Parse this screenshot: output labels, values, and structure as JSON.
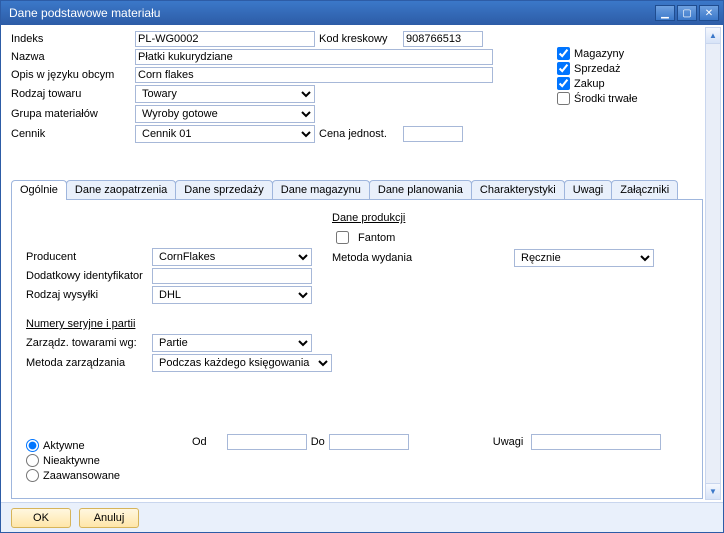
{
  "window": {
    "title": "Dane podstawowe materiału"
  },
  "header": {
    "indeks_label": "Indeks",
    "indeks_value": "PL-WG0002",
    "kod_label": "Kod kreskowy",
    "kod_value": "908766513",
    "nazwa_label": "Nazwa",
    "nazwa_value": "Płatki kukurydziane",
    "opis_label": "Opis w języku obcym",
    "opis_value": "Corn flakes",
    "rodzaj_label": "Rodzaj towaru",
    "rodzaj_value": "Towary",
    "grupa_label": "Grupa materiałów",
    "grupa_value": "Wyroby gotowe",
    "cennik_label": "Cennik",
    "cennik_value": "Cennik 01",
    "cena_label": "Cena jednost.",
    "cena_value": ""
  },
  "checks": {
    "magazyny": "Magazyny",
    "sprzedaz": "Sprzedaż",
    "zakup": "Zakup",
    "srodki": "Środki trwałe"
  },
  "tabs": {
    "ogolnie": "Ogólnie",
    "zaopatrzenia": "Dane zaopatrzenia",
    "sprzedazy": "Dane sprzedaży",
    "magazynu": "Dane magazynu",
    "planowania": "Dane planowania",
    "charakt": "Charakterystyki",
    "uwagi": "Uwagi",
    "zalaczniki": "Załączniki"
  },
  "panel": {
    "producent_label": "Producent",
    "producent_value": "CornFlakes",
    "dodatkowy_label": "Dodatkowy identyfikator",
    "dodatkowy_value": "",
    "rodzajwysylki_label": "Rodzaj wysyłki",
    "rodzajwysylki_value": "DHL",
    "numery_title": "Numery seryjne i partii",
    "zarzadz_label": "Zarządz. towarami wg:",
    "zarzadz_value": "Partie",
    "metoda_label": "Metoda zarządzania",
    "metoda_value": "Podczas każdego księgowania",
    "daneprod_title": "Dane produkcji",
    "fantom_label": "Fantom",
    "metodawyd_label": "Metoda wydania",
    "metodawyd_value": "Ręcznie",
    "aktywne": "Aktywne",
    "nieaktywne": "Nieaktywne",
    "zaawansowane": "Zaawansowane",
    "od_label": "Od",
    "do_label": "Do",
    "uwagi_label": "Uwagi"
  },
  "footer": {
    "ok": "OK",
    "anuluj": "Anuluj"
  }
}
